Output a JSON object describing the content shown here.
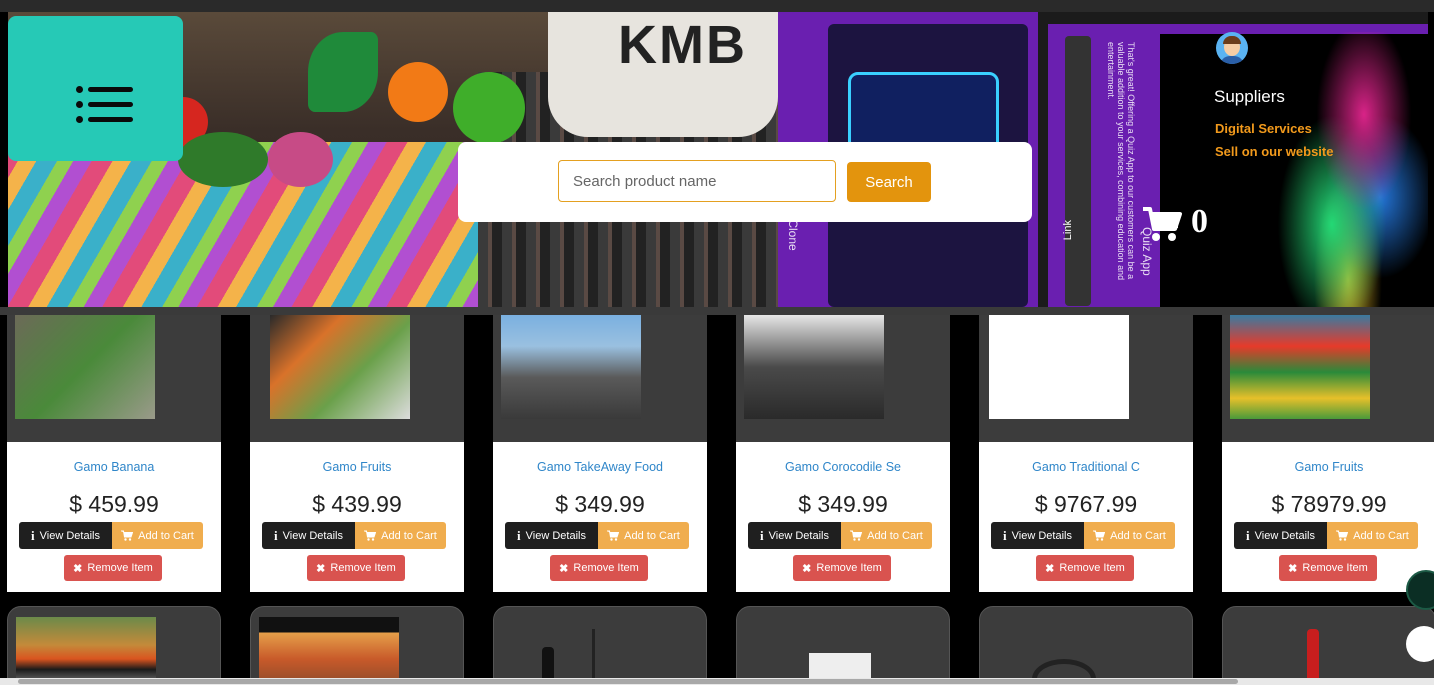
{
  "banner": {
    "brand_text": "KMB",
    "promo_vertical_1": "That's great! Offering a Quiz App to our customers can be a valuable addition to your services, combining education and entertainment.",
    "promo_vertical_2": "Quiz App",
    "promo_vertical_3": "r Clone",
    "link_label": "Link"
  },
  "search": {
    "placeholder": "Search product name",
    "button_label": "Search"
  },
  "suppliers": {
    "title": "Suppliers",
    "links": [
      "Digital Services",
      "Sell on our website"
    ]
  },
  "cart": {
    "count": "0"
  },
  "product_buttons": {
    "view": "View Details",
    "add": "Add to Cart",
    "remove": "Remove Item"
  },
  "products": [
    {
      "name": "Gamo Banana",
      "price": "$ 459.99"
    },
    {
      "name": "Gamo Fruits",
      "price": "$ 439.99"
    },
    {
      "name": "Gamo TakeAway Food",
      "price": "$ 349.99"
    },
    {
      "name": "Gamo Corocodile Se",
      "price": "$ 349.99"
    },
    {
      "name": "Gamo Traditional C",
      "price": "$ 9767.99"
    },
    {
      "name": "Gamo Fruits",
      "price": "$ 78979.99"
    }
  ],
  "colors": {
    "menu_bg": "#26c9b6",
    "search_button": "#e3940d",
    "product_name": "#2f86c9",
    "add_to_cart": "#f0ad4e",
    "remove": "#d9534f",
    "suppliers_link": "#f29a1c"
  }
}
